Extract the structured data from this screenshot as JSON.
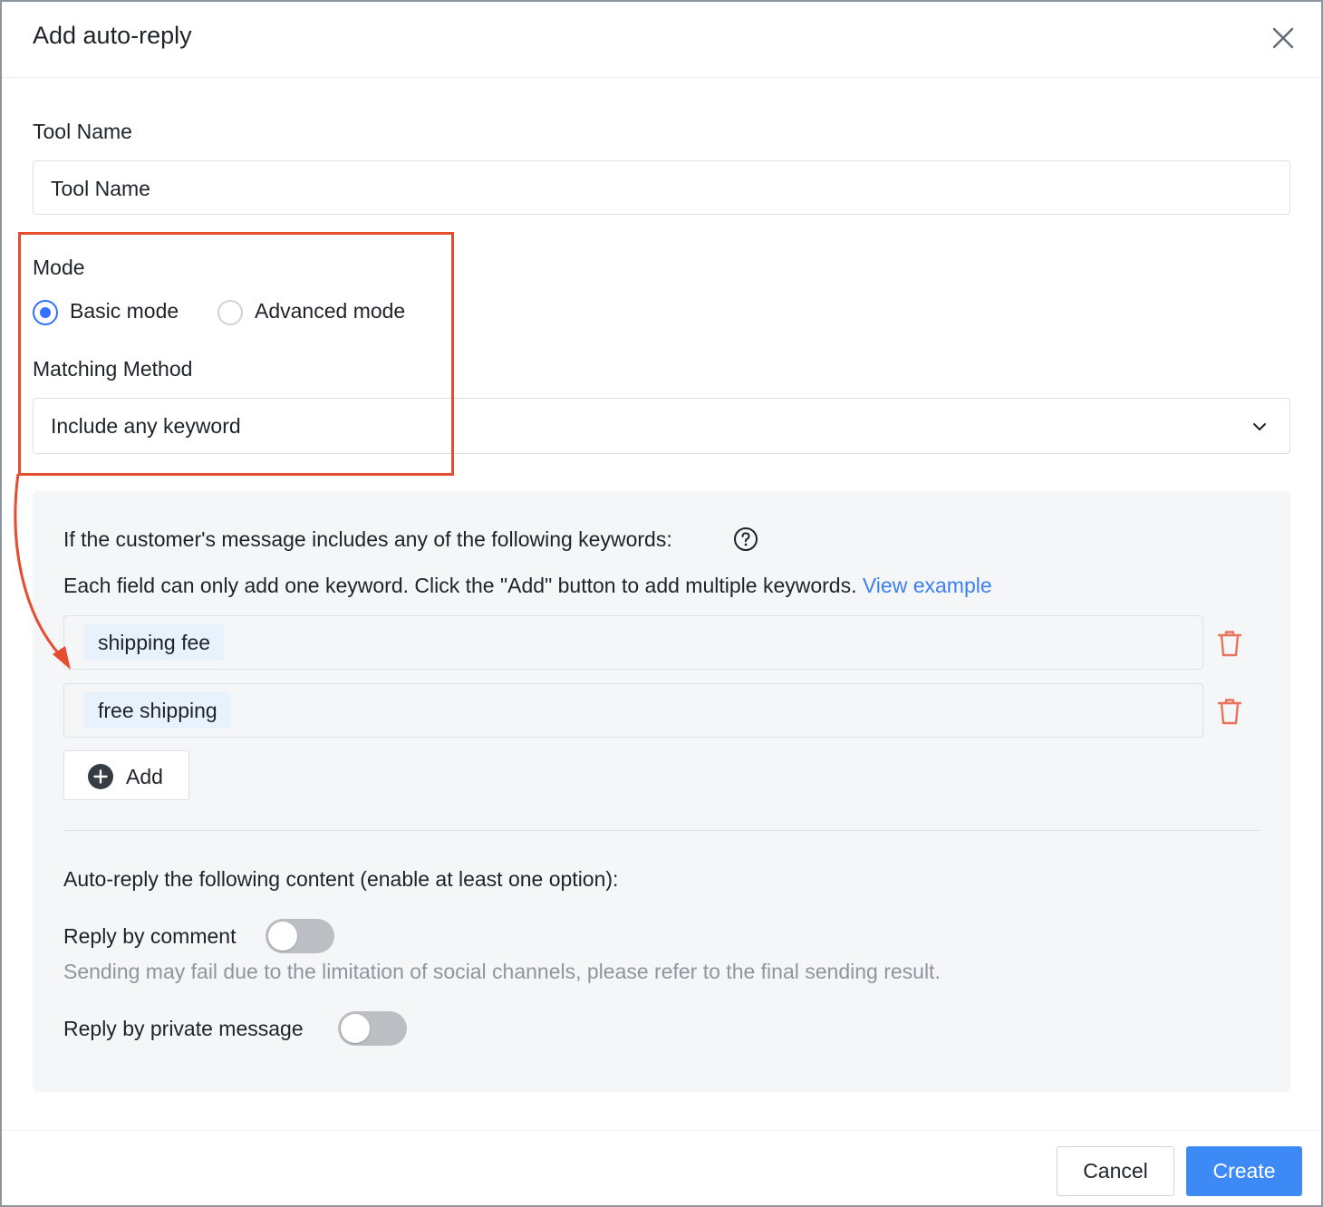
{
  "dialog": {
    "title": "Add auto-reply",
    "close_icon": "close-icon"
  },
  "tool_name": {
    "label": "Tool Name",
    "value": "Tool Name"
  },
  "mode": {
    "label": "Mode",
    "options": [
      {
        "label": "Basic mode",
        "checked": true
      },
      {
        "label": "Advanced mode",
        "checked": false
      }
    ]
  },
  "matching_method": {
    "label": "Matching Method",
    "value": "Include any keyword"
  },
  "keywords_panel": {
    "intro": "If the customer's message includes any of the following keywords:",
    "help_icon": "question-circle-icon",
    "instruction": "Each field can only add one keyword. Click the \"Add\" button to add multiple keywords.",
    "view_example": "View example",
    "keywords": [
      "shipping fee",
      "free shipping"
    ],
    "add_label": "Add"
  },
  "auto_reply": {
    "heading": "Auto-reply the following content (enable at least one option):",
    "reply_comment": {
      "label": "Reply by comment",
      "enabled": false
    },
    "comment_hint": "Sending may fail due to the limitation of social channels, please refer to the final sending result.",
    "reply_private": {
      "label": "Reply by private message",
      "enabled": false
    }
  },
  "footer": {
    "cancel": "Cancel",
    "create": "Create"
  },
  "colors": {
    "primary": "#3d8af7",
    "radio_checked": "#3370ff",
    "link": "#3d7ff0",
    "delete_icon": "#e8735a",
    "annotation": "#e64c2e"
  }
}
